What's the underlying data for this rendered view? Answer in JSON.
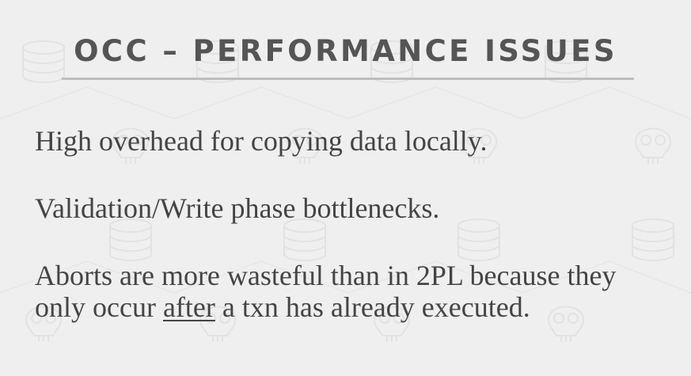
{
  "slide": {
    "title": "OCC – PERFORMANCE ISSUES",
    "bullets": [
      {
        "text": "High overhead for copying data locally."
      },
      {
        "text": "Validation/Write phase bottlenecks."
      },
      {
        "line1": "Aborts are more wasteful than in 2PL because they",
        "line2_before": "only occur ",
        "line2_emphasis": "after",
        "line2_after": " a txn has already executed."
      }
    ]
  },
  "colors": {
    "background": "#efefef",
    "title": "#555555",
    "body_text": "#444444",
    "rule": "#bdbdbd"
  },
  "icons": [
    "database-icon",
    "skull-icon"
  ]
}
